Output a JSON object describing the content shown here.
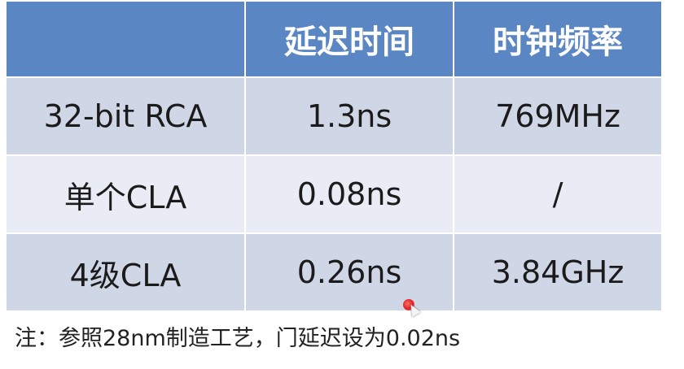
{
  "table": {
    "headers": [
      "",
      "延迟时间",
      "时钟频率"
    ],
    "rows": [
      [
        "32-bit RCA",
        "1.3ns",
        "769MHz"
      ],
      [
        "单个CLA",
        "0.08ns",
        "/"
      ],
      [
        "4级CLA",
        "0.26ns",
        "3.84GHz"
      ]
    ]
  },
  "note": "注：参照28nm制造工艺，门延迟设为0.02ns",
  "colors": {
    "header_bg": "#5b86c4",
    "row_dark": "#cfd6e6",
    "row_light": "#e9ecf4"
  }
}
